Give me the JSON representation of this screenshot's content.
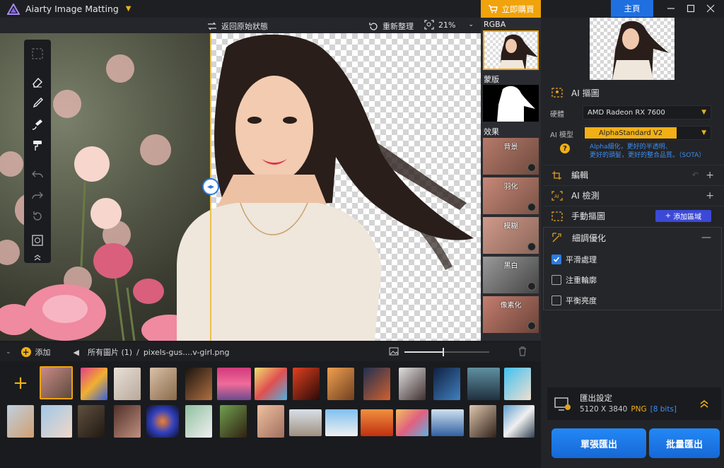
{
  "app": {
    "title": "Aiarty Image Matting"
  },
  "titlebar": {
    "buy_label": "立即購買",
    "home_label": "主頁"
  },
  "toolbar": {
    "revert_label": "返回原始狀態",
    "reset_label": "重新整理",
    "zoom": "21%"
  },
  "strip": {
    "rgba_label": "RGBA",
    "mask_label": "蒙版",
    "effects_label": "效果",
    "effects": [
      {
        "label": "背景"
      },
      {
        "label": "羽化"
      },
      {
        "label": "模糊"
      },
      {
        "label": "黑白"
      },
      {
        "label": "像素化"
      }
    ]
  },
  "panel": {
    "ai_matting_title": "AI 摳圖",
    "hardware_label": "硬體",
    "hardware_value": "AMD Radeon RX 7600",
    "model_label": "AI 模型",
    "model_value": "AlphaStandard  V2",
    "model_desc_1": "Alpha細化，更好的半透明、",
    "model_desc_2": "更好的頭髮，更好的整合品質。（SOTA）",
    "edit_title": "編輯",
    "ai_detect_title": "AI 檢測",
    "manual_title": "手動摳圖",
    "add_region_label": "添加區域",
    "refine_title": "細調優化",
    "refine_options": [
      {
        "label": "平滑處理",
        "checked": true
      },
      {
        "label": "注重輪廓",
        "checked": false
      },
      {
        "label": "平衡亮度",
        "checked": false
      }
    ]
  },
  "export": {
    "title": "匯出設定",
    "size": "5120 X 3840",
    "format": "PNG",
    "bits": "[8 bits]",
    "single_label": "單張匯出",
    "batch_label": "批量匯出"
  },
  "bottom": {
    "add_label": "添加",
    "breadcrumb_all": "所有圖片 (1)",
    "separator": "/",
    "file_name": "pixels-gus....v-girl.png",
    "zoom_slider": 0.45
  },
  "colors": {
    "accent": "#1f6fe0",
    "buy": "#f0a30a",
    "model_bg": "#f2b016",
    "compare_line": "#e8c050"
  }
}
